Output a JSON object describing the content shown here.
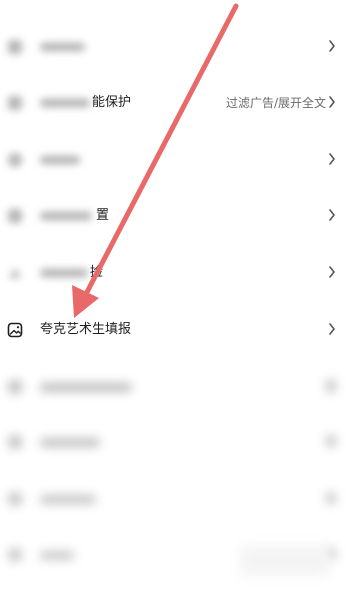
{
  "settings_list": {
    "items": [
      {
        "id": "item1",
        "label": "",
        "value": "",
        "icon": "blurred-icon"
      },
      {
        "id": "item2",
        "label": "能保护",
        "value": "过滤广告/展开全文",
        "icon": "shield-icon"
      },
      {
        "id": "item3",
        "label": "",
        "value": "",
        "icon": "blurred-icon"
      },
      {
        "id": "item4",
        "label": "置",
        "value": "",
        "icon": "blurred-icon"
      },
      {
        "id": "item5",
        "label": "捡",
        "value": "",
        "icon": "blurred-icon"
      },
      {
        "id": "item6",
        "label": "夸克艺术生填报",
        "value": "",
        "icon": "image-icon"
      },
      {
        "id": "item7",
        "label": "",
        "value": "",
        "icon": "blurred-icon"
      },
      {
        "id": "item8",
        "label": "",
        "value": "",
        "icon": "blurred-icon"
      },
      {
        "id": "item9",
        "label": "",
        "value": "",
        "icon": "blurred-icon"
      },
      {
        "id": "item10",
        "label": "",
        "value": "",
        "icon": "blurred-icon"
      }
    ]
  },
  "colors": {
    "arrow": "#e96868",
    "text": "#1f1f1f",
    "secondary": "#6b6b6b",
    "chevron": "#555555"
  }
}
